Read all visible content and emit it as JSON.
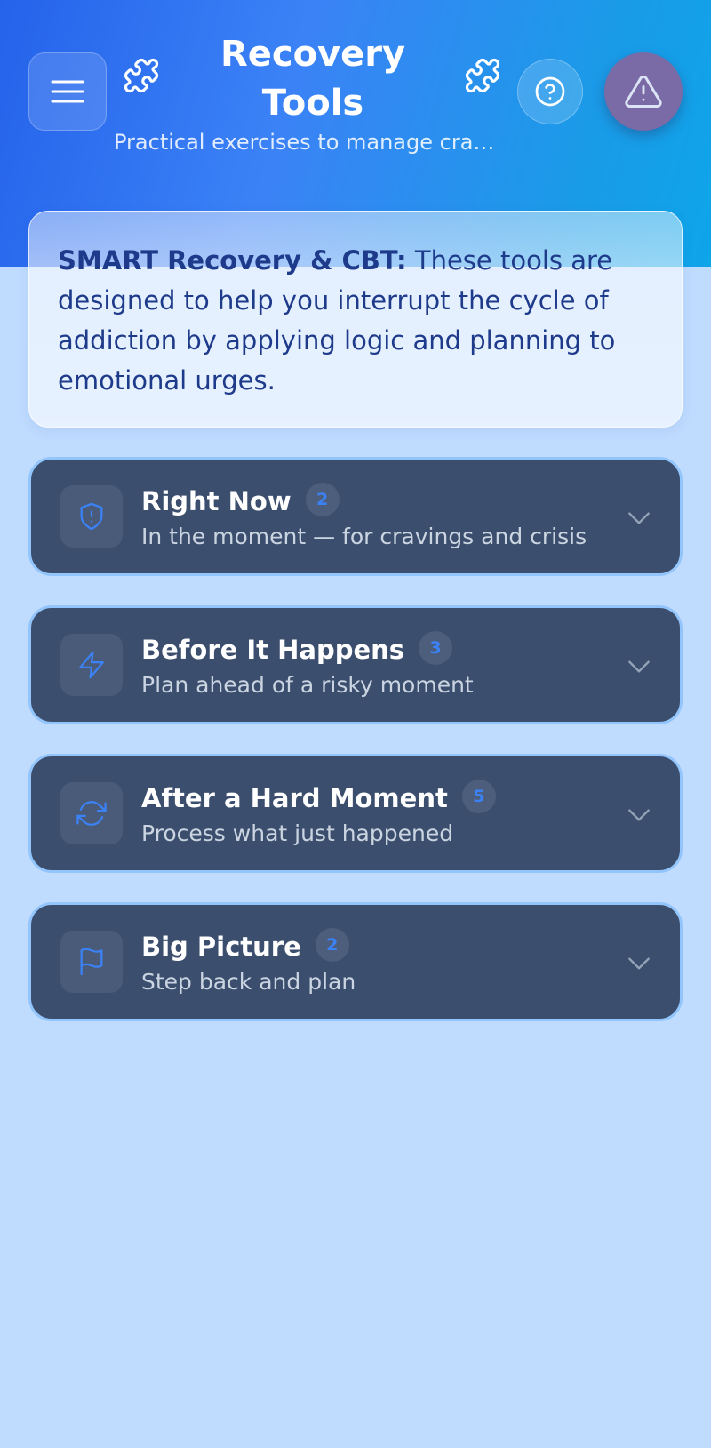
{
  "header": {
    "title": "Recovery Tools",
    "subtitle": "Practical exercises to manage cravings and crisis",
    "menu_icon": "menu-icon",
    "decor_icon": "puzzle-icon",
    "help_icon": "help-circle-icon",
    "alert_icon": "alert-triangle-icon"
  },
  "intro": {
    "strong": "SMART Recovery & CBT:",
    "text": " These tools are designed to help you interrupt the cycle of addiction by applying logic and planning to emotional urges."
  },
  "sections": [
    {
      "title": "Right Now",
      "count": "2",
      "subtitle": "In the moment — for cravings and crisis",
      "icon": "shield-alert-icon"
    },
    {
      "title": "Before It Happens",
      "count": "3",
      "subtitle": "Plan ahead of a risky moment",
      "icon": "lightning-icon"
    },
    {
      "title": "After a Hard Moment",
      "count": "5",
      "subtitle": "Process what just happened",
      "icon": "refresh-icon"
    },
    {
      "title": "Big Picture",
      "count": "2",
      "subtitle": "Step back and plan",
      "icon": "flag-icon"
    }
  ],
  "colors": {
    "header_gradient_start": "#2563eb",
    "header_gradient_end": "#0ea5e9",
    "page_background": "#bfdbfe",
    "card_background": "#3b4e6e",
    "card_border": "#93c5fd",
    "accent": "#3b82f6",
    "alert_button": "#7a6aa6",
    "intro_text": "#1e3a8a"
  }
}
